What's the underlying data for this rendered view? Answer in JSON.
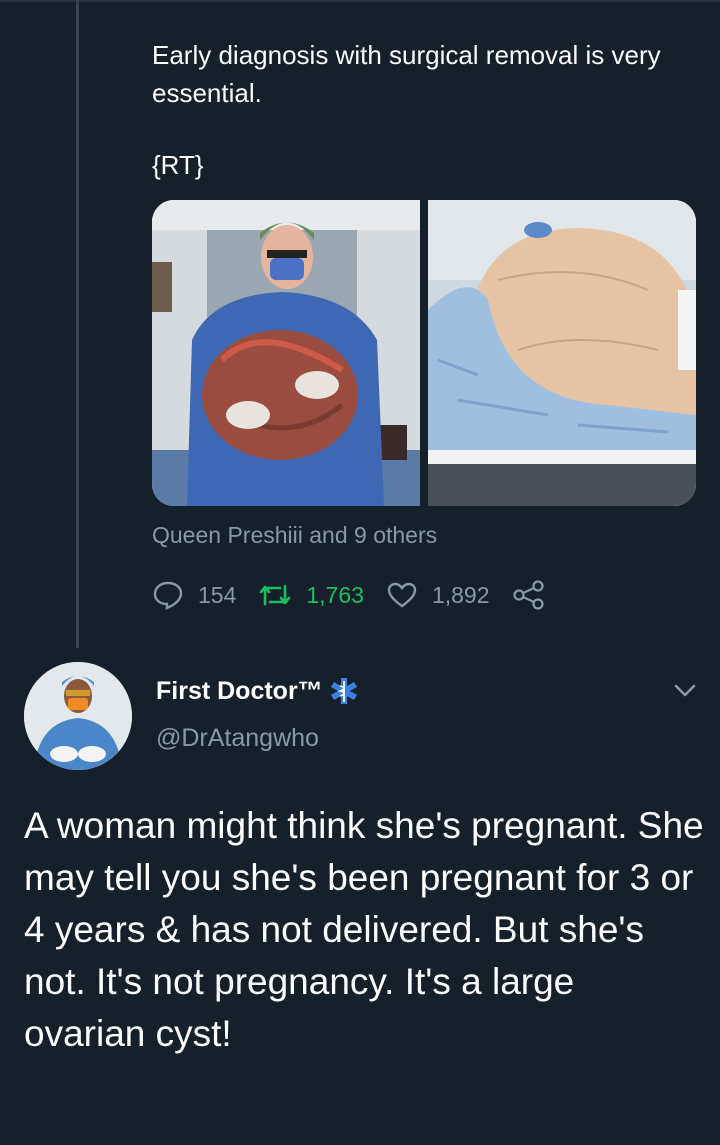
{
  "thread_tweet": {
    "text": "Early diagnosis with surgical removal is very essential.",
    "rt_tag": "{RT}",
    "liked_by": "Queen Preshiii and 9 others",
    "counts": {
      "replies": "154",
      "retweets": "1,763",
      "likes": "1,892"
    }
  },
  "main_tweet": {
    "display_name": "First Doctor™",
    "handle": "@DrAtangwho",
    "text": "A woman might think she's pregnant. She may tell you she's been pregnant for 3 or 4 years & has not delivered. But she's not. It's not pregnancy. It's a large ovarian cyst!"
  },
  "colors": {
    "background": "#15202b",
    "secondary_text": "#8899a6",
    "retweet_green": "#17bf63",
    "thread_line": "#38444d"
  },
  "icons": [
    "reply-icon",
    "retweet-icon",
    "like-icon",
    "share-icon",
    "medical-badge-icon",
    "chevron-down-icon"
  ]
}
